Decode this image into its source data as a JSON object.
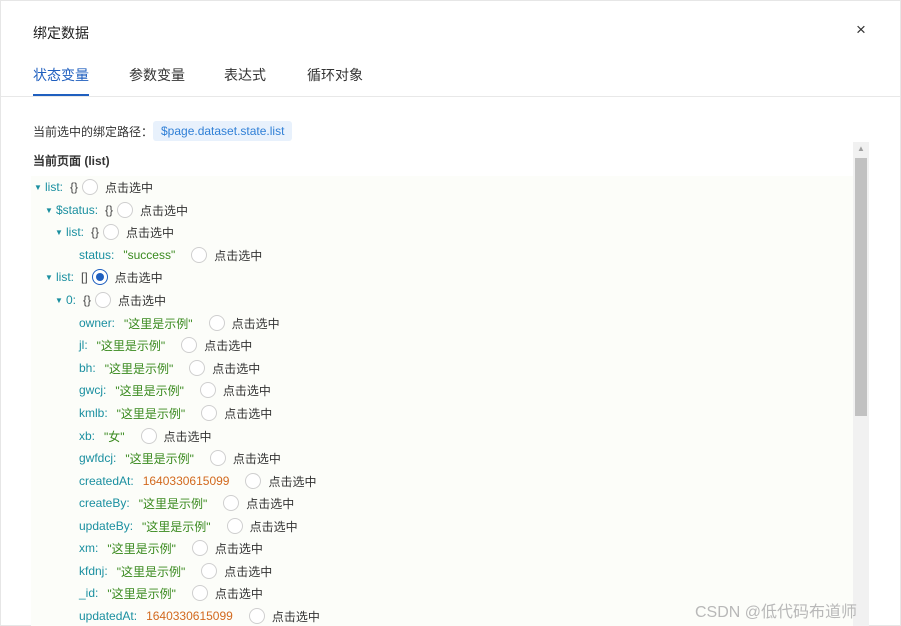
{
  "dialog": {
    "title": "绑定数据",
    "close_glyph": "×"
  },
  "tabs": [
    {
      "label": "状态变量",
      "active": true
    },
    {
      "label": "参数变量",
      "active": false
    },
    {
      "label": "表达式",
      "active": false
    },
    {
      "label": "循环对象",
      "active": false
    }
  ],
  "binding_path": {
    "label": "当前选中的绑定路径：",
    "value": "$page.dataset.state.list"
  },
  "section_title": "当前页面 (list)",
  "select_label": "点击选中",
  "tree": {
    "list_key": "list:",
    "list_brace": "{}",
    "status_key": "$status:",
    "status_brace": "{}",
    "inner_list_key": "list:",
    "inner_list_brace": "{}",
    "status_field_key": "status:",
    "status_field_value": "\"success\"",
    "array_key": "list:",
    "array_brace": "[]",
    "item_key": "0:",
    "item_brace": "{}",
    "fields": [
      {
        "key": "owner:",
        "value": "\"这里是示例\""
      },
      {
        "key": "jl:",
        "value": "\"这里是示例\""
      },
      {
        "key": "bh:",
        "value": "\"这里是示例\""
      },
      {
        "key": "gwcj:",
        "value": "\"这里是示例\""
      },
      {
        "key": "kmlb:",
        "value": "\"这里是示例\""
      },
      {
        "key": "xb:",
        "value": "\"女\""
      },
      {
        "key": "gwfdcj:",
        "value": "\"这里是示例\""
      },
      {
        "key": "createdAt:",
        "value": "1640330615099"
      },
      {
        "key": "createBy:",
        "value": "\"这里是示例\""
      },
      {
        "key": "updateBy:",
        "value": "\"这里是示例\""
      },
      {
        "key": "xm:",
        "value": "\"这里是示例\""
      },
      {
        "key": "kfdnj:",
        "value": "\"这里是示例\""
      },
      {
        "key": "_id:",
        "value": "\"这里是示例\""
      },
      {
        "key": "updatedAt:",
        "value": "1640330615099"
      }
    ]
  },
  "watermark": "CSDN @低代码布道师",
  "colors": {
    "accent": "#1f5fbf",
    "key": "#1a8fa0",
    "string_value": "#3a8a1f",
    "number_value": "#d2691e",
    "chip_bg": "#e8f1fc"
  },
  "icons": {
    "close": "close-icon",
    "expand": "caret-down-icon",
    "scroll_up": "arrow-up-icon"
  }
}
